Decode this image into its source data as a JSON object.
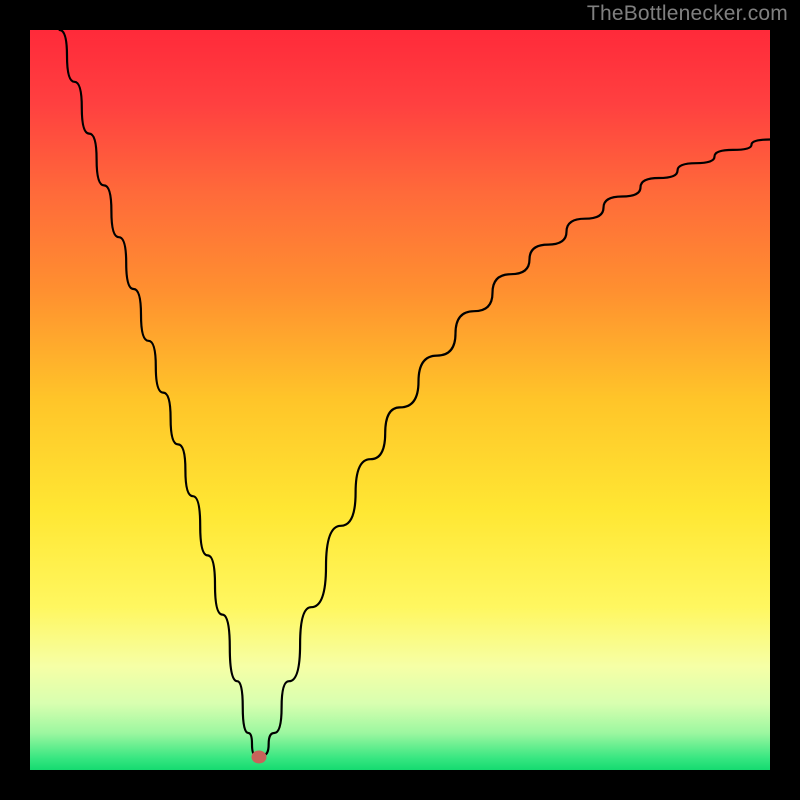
{
  "watermark": "TheBottlenecker.com",
  "chart_data": {
    "type": "line",
    "title": "",
    "xlabel": "",
    "ylabel": "",
    "xlim": [
      0,
      100
    ],
    "ylim": [
      0,
      100
    ],
    "series": [
      {
        "name": "bottleneck-curve",
        "x": [
          4,
          6,
          8,
          10,
          12,
          14,
          16,
          18,
          20,
          22,
          24,
          26,
          28,
          29.5,
          30.5,
          31.5,
          33,
          35,
          38,
          42,
          46,
          50,
          55,
          60,
          65,
          70,
          75,
          80,
          85,
          90,
          95,
          100
        ],
        "y": [
          100,
          93,
          86,
          79,
          72,
          65,
          58,
          51,
          44,
          37,
          29,
          21,
          12,
          5,
          2,
          2,
          5,
          12,
          22,
          33,
          42,
          49,
          56,
          62,
          67,
          71,
          74.5,
          77.5,
          80,
          82,
          83.8,
          85.2
        ]
      }
    ],
    "marker": {
      "x": 31,
      "y": 1.8,
      "color": "#c8635a"
    },
    "gradient_stops": [
      {
        "pos": 0.0,
        "color": "#ff2a3a"
      },
      {
        "pos": 0.1,
        "color": "#ff4040"
      },
      {
        "pos": 0.22,
        "color": "#ff6a3a"
      },
      {
        "pos": 0.35,
        "color": "#ff8f30"
      },
      {
        "pos": 0.5,
        "color": "#ffc529"
      },
      {
        "pos": 0.65,
        "color": "#ffe733"
      },
      {
        "pos": 0.78,
        "color": "#fff760"
      },
      {
        "pos": 0.86,
        "color": "#f6ffa6"
      },
      {
        "pos": 0.91,
        "color": "#d8ffb0"
      },
      {
        "pos": 0.95,
        "color": "#9cf7a0"
      },
      {
        "pos": 0.985,
        "color": "#35e680"
      },
      {
        "pos": 1.0,
        "color": "#15db70"
      }
    ],
    "frame_color": "#000000",
    "curve_color": "#000000",
    "curve_width": 2.2
  }
}
